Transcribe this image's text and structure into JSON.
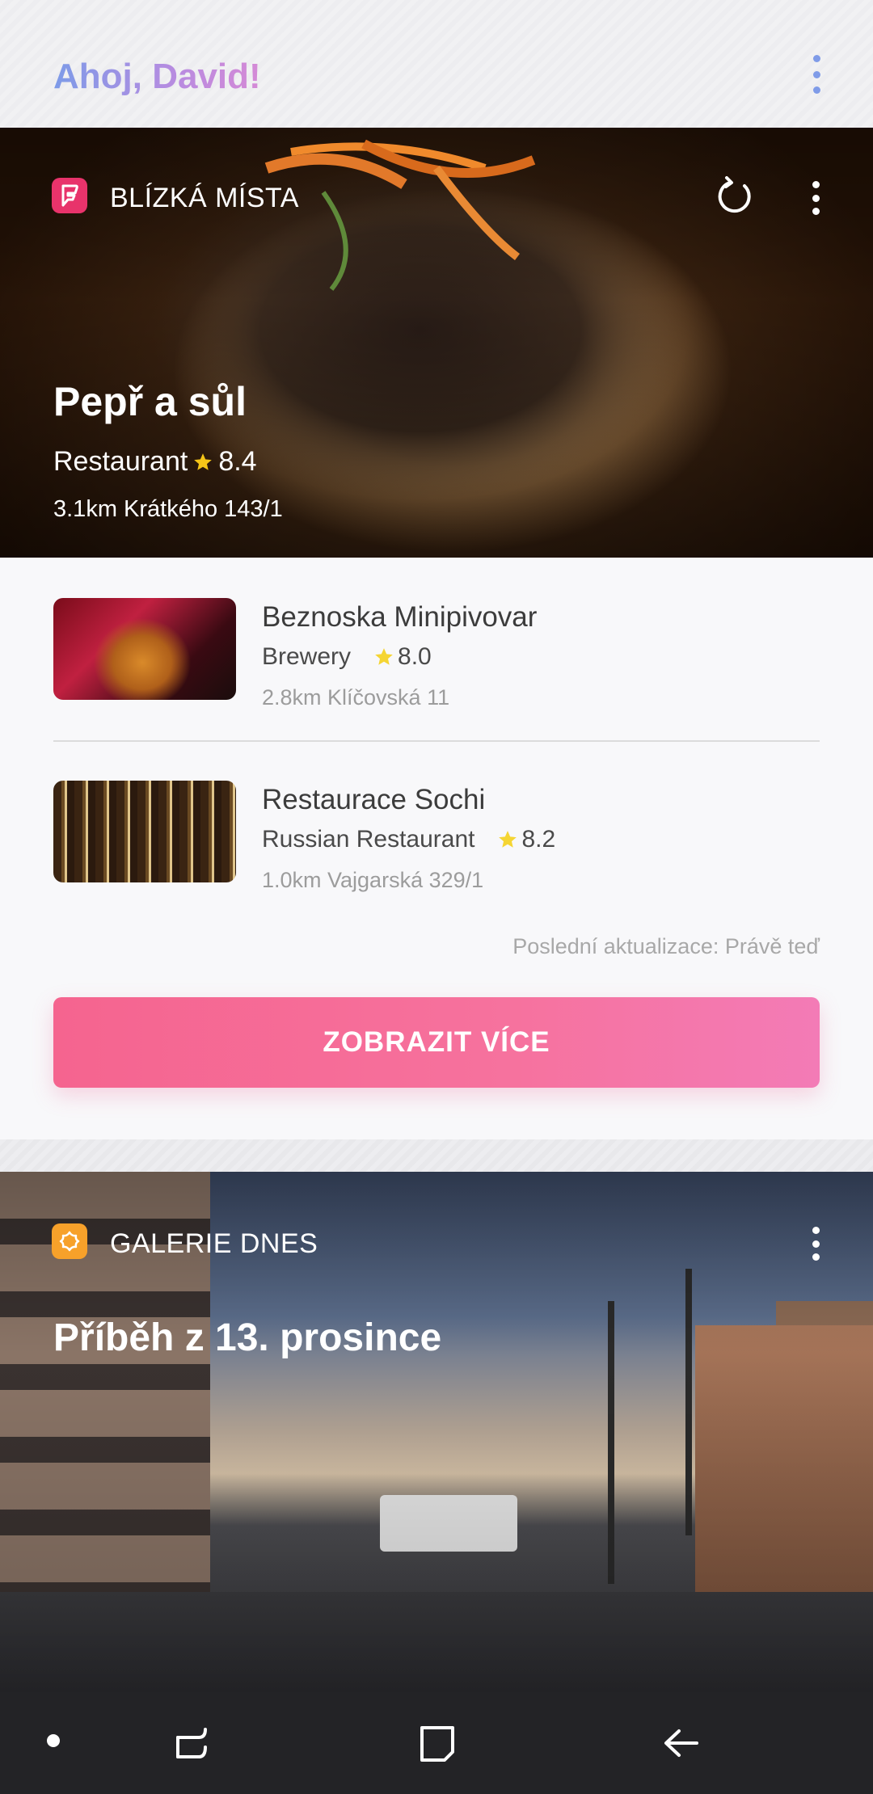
{
  "greeting": "Ahoj, David!",
  "places_card": {
    "header_title": "BLÍZKÁ MÍSTA",
    "hero": {
      "name": "Pepř a sůl",
      "category": "Restaurant",
      "rating": "8.4",
      "address": "3.1km Krátkého 143/1"
    },
    "items": [
      {
        "name": "Beznoska Minipivovar",
        "category": "Brewery",
        "rating": "8.0",
        "address": "2.8km Klíčovská 11"
      },
      {
        "name": "Restaurace Sochi",
        "category": "Russian Restaurant",
        "rating": "8.2",
        "address": "1.0km Vajgarská 329/1"
      }
    ],
    "last_update": "Poslední aktualizace: Právě teď",
    "more_button": "ZOBRAZIT VÍCE"
  },
  "gallery_card": {
    "header_title": "GALERIE DNES",
    "title": "Příběh z 13. prosince"
  },
  "colors": {
    "greeting_gradient_start": "#7d9be8",
    "greeting_gradient_end": "#d58ad6",
    "button_pink": "#f5648f",
    "star_yellow": "#f5c518",
    "foursquare_pink": "#e8336b",
    "gallery_orange": "#f7a12a"
  },
  "icons": {
    "overflow": "kebab-menu-icon",
    "refresh": "refresh-icon",
    "star": "star-icon",
    "nav": [
      "nav-dot-icon",
      "recent-apps-icon",
      "home-icon",
      "back-icon"
    ]
  }
}
